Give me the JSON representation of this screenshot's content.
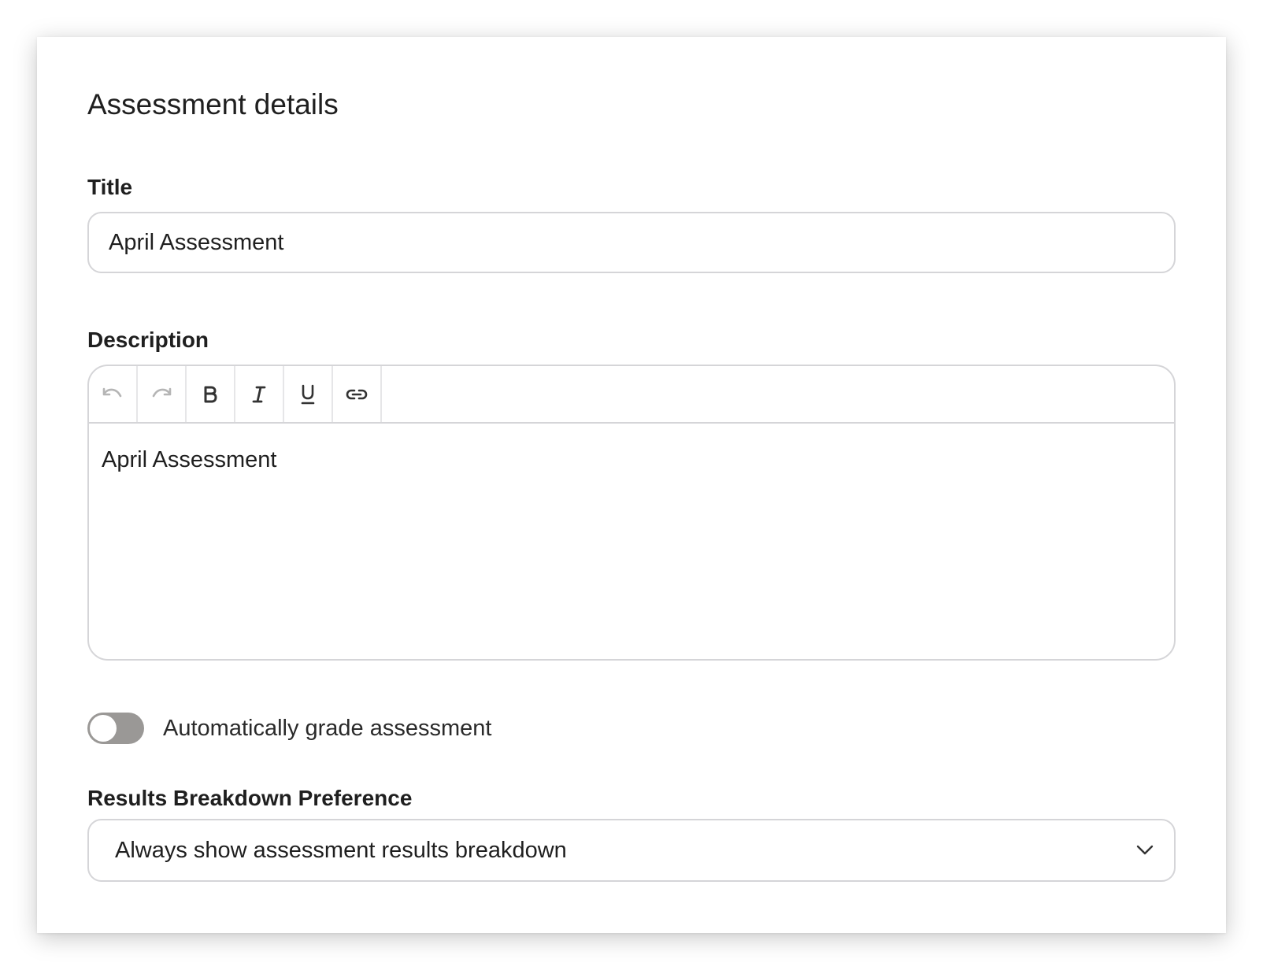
{
  "form": {
    "heading": "Assessment details",
    "title_label": "Title",
    "title_value": "April Assessment",
    "description_label": "Description",
    "description_content": "April Assessment",
    "toolbar": [
      "undo-icon",
      "redo-icon",
      "bold-icon",
      "italic-icon",
      "underline-icon",
      "link-icon"
    ],
    "auto_grade": {
      "label": "Automatically grade assessment",
      "enabled": false
    },
    "results_label": "Results Breakdown Preference",
    "results_value": "Always show assessment results breakdown"
  },
  "colors": {
    "toggle_off": "#9a9896",
    "border": "#d5d5d8",
    "text": "#1f1f1f",
    "icon_muted": "#b5b5b5",
    "icon": "#333333"
  }
}
